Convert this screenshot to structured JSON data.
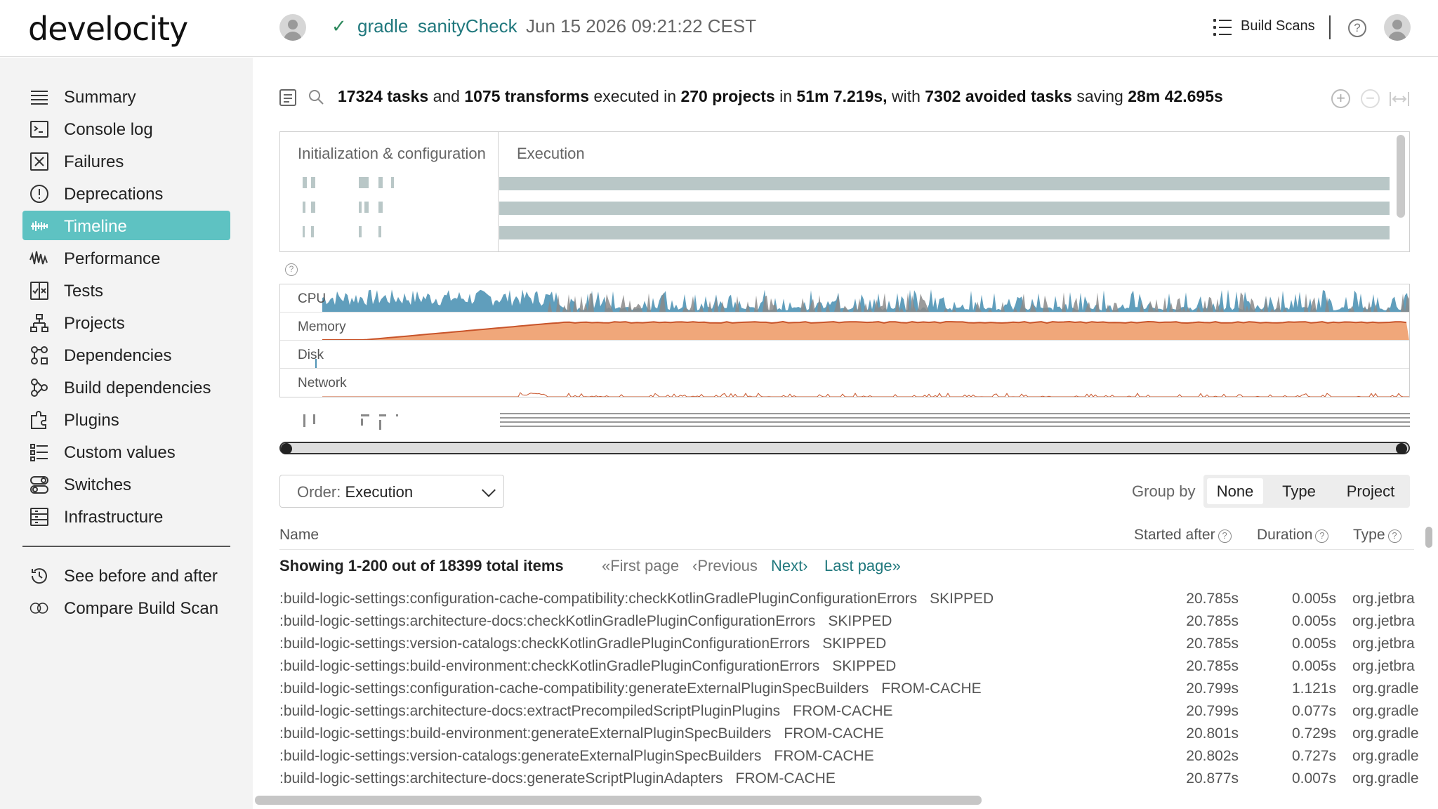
{
  "header": {
    "logo": "develocity",
    "project": "gradle",
    "task": "sanityCheck",
    "timestamp": "Jun 15 2026 09:21:22 CEST",
    "build_scans_label": "Build Scans",
    "help_glyph": "?"
  },
  "sidebar": {
    "items": [
      {
        "label": "Summary",
        "icon": "summary-icon"
      },
      {
        "label": "Console log",
        "icon": "console-icon"
      },
      {
        "label": "Failures",
        "icon": "failures-icon"
      },
      {
        "label": "Deprecations",
        "icon": "deprecations-icon"
      },
      {
        "label": "Timeline",
        "icon": "timeline-icon",
        "active": true
      },
      {
        "label": "Performance",
        "icon": "performance-icon"
      },
      {
        "label": "Tests",
        "icon": "tests-icon"
      },
      {
        "label": "Projects",
        "icon": "projects-icon"
      },
      {
        "label": "Dependencies",
        "icon": "dependencies-icon"
      },
      {
        "label": "Build dependencies",
        "icon": "build-dependencies-icon"
      },
      {
        "label": "Plugins",
        "icon": "plugins-icon"
      },
      {
        "label": "Custom values",
        "icon": "custom-values-icon"
      },
      {
        "label": "Switches",
        "icon": "switches-icon"
      },
      {
        "label": "Infrastructure",
        "icon": "infrastructure-icon"
      }
    ],
    "bottom_items": [
      {
        "label": "See before and after",
        "icon": "history-icon"
      },
      {
        "label": "Compare Build Scan",
        "icon": "compare-icon"
      }
    ]
  },
  "summary": {
    "tasks_count": "17324 tasks",
    "and": "and",
    "transforms_count": "1075 transforms",
    "executed_in": "executed in",
    "projects_count": "270 projects",
    "in": "in",
    "duration": "51m 7.219s,",
    "with": "with",
    "avoided_count": "7302 avoided tasks",
    "saving": "saving",
    "saved_time": "28m 42.695s"
  },
  "timeline": {
    "init_label": "Initialization & configuration",
    "exec_label": "Execution"
  },
  "resources": {
    "labels": [
      "CPU",
      "Memory",
      "Disk",
      "Network"
    ],
    "help_glyph": "?"
  },
  "controls": {
    "order_prefix": "Order:",
    "order_value": "Execution",
    "group_by_label": "Group by",
    "group_options": [
      "None",
      "Type",
      "Project"
    ],
    "group_selected": "None"
  },
  "table": {
    "col_name": "Name",
    "col_started": "Started after",
    "col_duration": "Duration",
    "col_type": "Type",
    "showing": "Showing 1-200 out of 18399 total items",
    "first_page": "«First page",
    "previous": "‹Previous",
    "next": "Next›",
    "last_page": "Last page»",
    "rows": [
      {
        "name": ":build-logic-settings:configuration-cache-compatibility:checkKotlinGradlePluginConfigurationErrors",
        "status": "SKIPPED",
        "started": "20.785s",
        "duration": "0.005s",
        "type": "org.jetbra"
      },
      {
        "name": ":build-logic-settings:architecture-docs:checkKotlinGradlePluginConfigurationErrors",
        "status": "SKIPPED",
        "started": "20.785s",
        "duration": "0.005s",
        "type": "org.jetbra"
      },
      {
        "name": ":build-logic-settings:version-catalogs:checkKotlinGradlePluginConfigurationErrors",
        "status": "SKIPPED",
        "started": "20.785s",
        "duration": "0.005s",
        "type": "org.jetbra"
      },
      {
        "name": ":build-logic-settings:build-environment:checkKotlinGradlePluginConfigurationErrors",
        "status": "SKIPPED",
        "started": "20.785s",
        "duration": "0.005s",
        "type": "org.jetbra"
      },
      {
        "name": ":build-logic-settings:configuration-cache-compatibility:generateExternalPluginSpecBuilders",
        "status": "FROM-CACHE",
        "started": "20.799s",
        "duration": "1.121s",
        "type": "org.gradle"
      },
      {
        "name": ":build-logic-settings:architecture-docs:extractPrecompiledScriptPluginPlugins",
        "status": "FROM-CACHE",
        "started": "20.799s",
        "duration": "0.077s",
        "type": "org.gradle"
      },
      {
        "name": ":build-logic-settings:build-environment:generateExternalPluginSpecBuilders",
        "status": "FROM-CACHE",
        "started": "20.801s",
        "duration": "0.729s",
        "type": "org.gradle"
      },
      {
        "name": ":build-logic-settings:version-catalogs:generateExternalPluginSpecBuilders",
        "status": "FROM-CACHE",
        "started": "20.802s",
        "duration": "0.727s",
        "type": "org.gradle"
      },
      {
        "name": ":build-logic-settings:architecture-docs:generateScriptPluginAdapters",
        "status": "FROM-CACHE",
        "started": "20.877s",
        "duration": "0.007s",
        "type": "org.gradle"
      }
    ]
  },
  "colors": {
    "accent": "#20787d",
    "active_nav": "#5ec2c2",
    "cpu_blue": "#4f93b5",
    "cpu_gray": "#8a8a8a",
    "memory_orange": "#f0a77a",
    "memory_line": "#c8542a",
    "timeline_bar": "#b9c7c7"
  }
}
